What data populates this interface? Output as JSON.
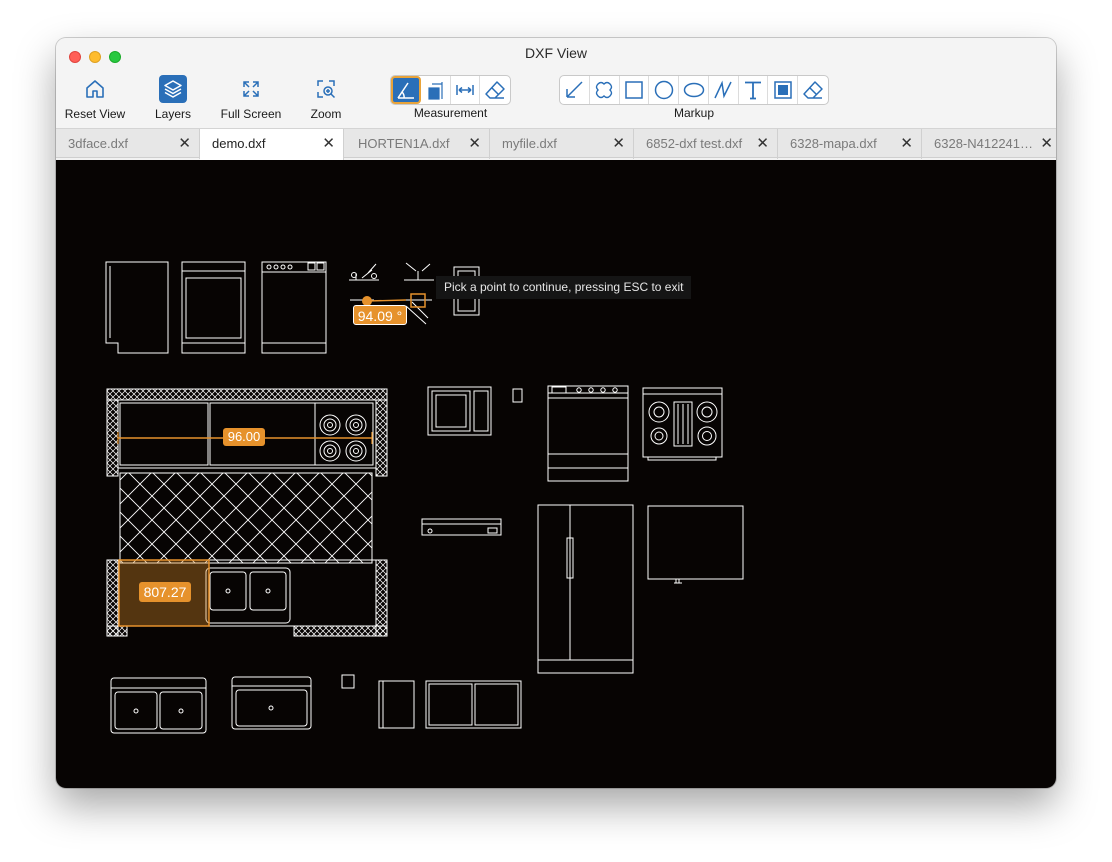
{
  "window": {
    "title": "DXF View"
  },
  "toolbar": {
    "reset_view": "Reset View",
    "layers": "Layers",
    "full_screen": "Full Screen",
    "zoom": "Zoom",
    "measurement_label": "Measurement",
    "markup_label": "Markup"
  },
  "tabs": [
    {
      "name": "3dface.dxf"
    },
    {
      "name": "demo.dxf"
    },
    {
      "name": "HORTEN1A.dxf"
    },
    {
      "name": "myfile.dxf"
    },
    {
      "name": "6852-dxf test.dxf"
    },
    {
      "name": "6328-mapa.dxf"
    },
    {
      "name": "6328-N412241…"
    }
  ],
  "active_tab": "demo.dxf",
  "canvas": {
    "tooltip": "Pick a point to continue, pressing ESC to exit",
    "measure_length": "96.00",
    "measure_area": "807.27",
    "measure_angle": "94.09 °"
  },
  "colors": {
    "accent": "#2a6fb8",
    "measure": "#e6922c",
    "canvas_bg": "#070403",
    "drawing": "#ffffff"
  },
  "icons": {
    "reset_view": "home-icon",
    "layers": "layers-icon",
    "full_screen": "expand-icon",
    "zoom": "zoom-icon",
    "measurement": [
      "angle-measure-icon",
      "vertical-measure-icon",
      "distance-measure-icon",
      "eraser-icon"
    ],
    "markup": [
      "arrow-icon",
      "cloud-icon",
      "rectangle-icon",
      "circle-icon",
      "ellipse-icon",
      "polyline-icon",
      "text-icon",
      "filled-rectangle-icon",
      "eraser-icon"
    ]
  }
}
